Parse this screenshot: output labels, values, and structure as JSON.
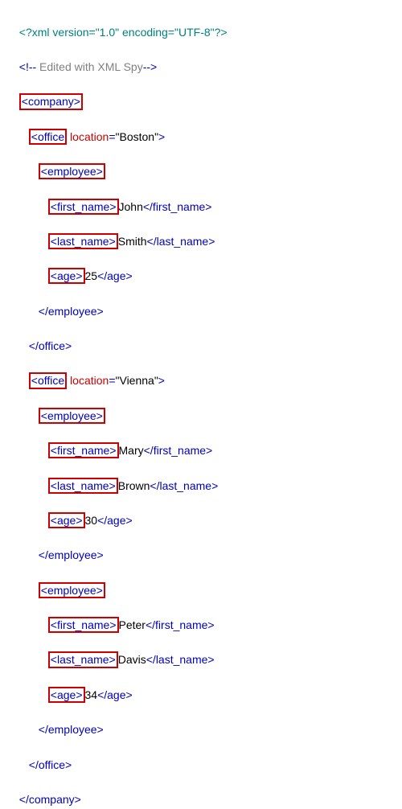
{
  "decl": "<?xml version=\"1.0\" encoding=\"UTF-8\"?>",
  "comment_open": "<!--",
  "comment_text": " Edited with XML Spy",
  "comment_close": "-->",
  "tags": {
    "company_open": "<company>",
    "company_close": "</company>",
    "office_open_tag": "<office",
    "office_close_tag": "</office>",
    "loc_attr": " location",
    "eq": "=",
    "gt": ">",
    "employee_open": "<employee>",
    "employee_close": "</employee>",
    "fn_open": "<first_name>",
    "fn_close": "</first_name>",
    "ln_open": "<last_name>",
    "ln_close": "</last_name>",
    "age_open": "<age>",
    "age_close": "</age>"
  },
  "offices": [
    {
      "location": "\"Boston\"",
      "employees": [
        {
          "first_name": "John",
          "last_name": "Smith",
          "age": "25"
        }
      ]
    },
    {
      "location": "\"Vienna\"",
      "employees": [
        {
          "first_name": "Mary",
          "last_name": "Brown",
          "age": "30"
        },
        {
          "first_name": "Peter",
          "last_name": "Davis",
          "age": "34"
        }
      ]
    }
  ]
}
